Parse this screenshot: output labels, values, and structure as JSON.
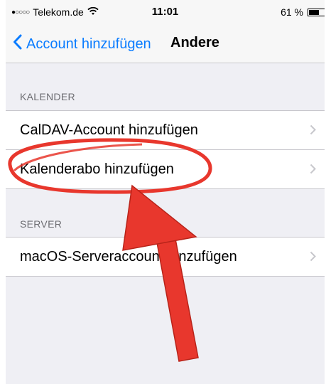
{
  "statusbar": {
    "signal": "●○○○○",
    "carrier": "Telekom.de",
    "time": "11:01",
    "battery": "61 %",
    "battery_level": 0.61
  },
  "navbar": {
    "back_label": "Account hinzufügen",
    "title": "Andere"
  },
  "sections": [
    {
      "header": "KALENDER",
      "items": [
        {
          "label": "CalDAV-Account hinzufügen"
        },
        {
          "label": "Kalenderabo hinzufügen"
        }
      ]
    },
    {
      "header": "SERVER",
      "items": [
        {
          "label": "macOS-Serveraccount hinzufügen"
        }
      ]
    }
  ],
  "colors": {
    "accent": "#0a7cff",
    "annotation": "#e8372d"
  }
}
